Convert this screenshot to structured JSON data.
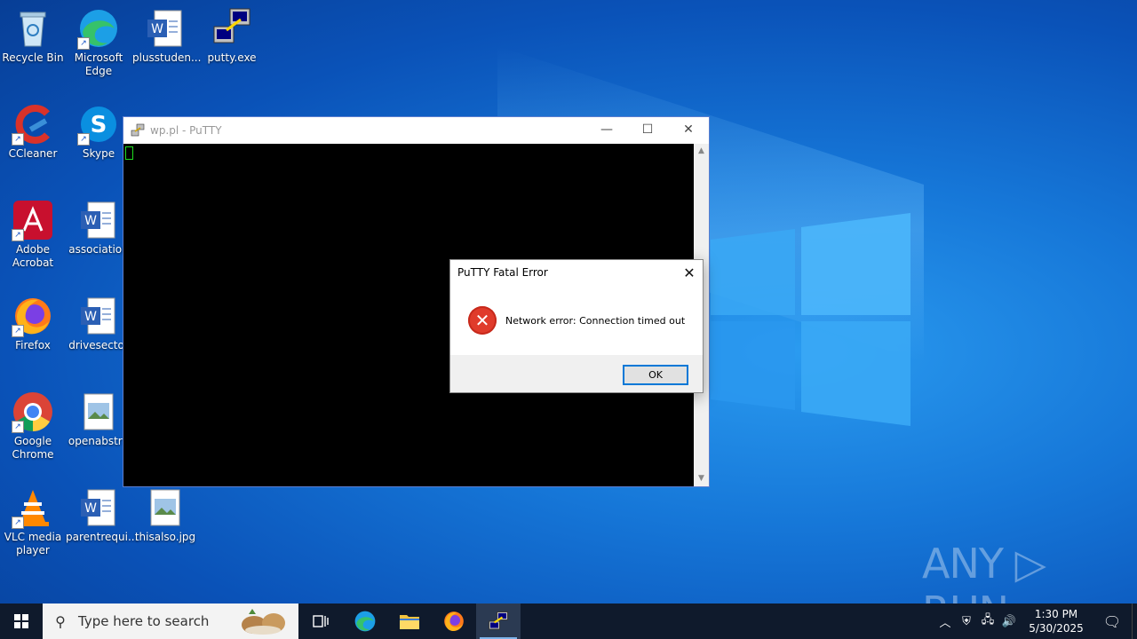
{
  "desktop": {
    "icons": [
      {
        "label": "Recycle Bin"
      },
      {
        "label": "Microsoft Edge"
      },
      {
        "label": "plusstuden..."
      },
      {
        "label": "putty.exe"
      },
      {
        "label": "CCleaner"
      },
      {
        "label": "Skype"
      },
      {
        "label": "Adobe Acrobat"
      },
      {
        "label": "association"
      },
      {
        "label": "Firefox"
      },
      {
        "label": "drivesector"
      },
      {
        "label": "Google Chrome"
      },
      {
        "label": "openabstra"
      },
      {
        "label": "VLC media player"
      },
      {
        "label": "parentrequi..."
      },
      {
        "label": "thisalso.jpg"
      }
    ]
  },
  "putty_window": {
    "title": "wp.pl - PuTTY",
    "minimize": "—",
    "maximize": "☐",
    "close": "✕"
  },
  "dialog": {
    "title": "PuTTY Fatal Error",
    "message": "Network error: Connection timed out",
    "ok_label": "OK",
    "close": "✕"
  },
  "watermark": "ANY ▷ RUN",
  "taskbar": {
    "search_placeholder": "Type here to search",
    "time": "1:30 PM",
    "date": "5/30/2025"
  },
  "colors": {
    "accent": "#0078d7",
    "error": "#e03b2b",
    "taskbar": "#0f1a2c"
  }
}
